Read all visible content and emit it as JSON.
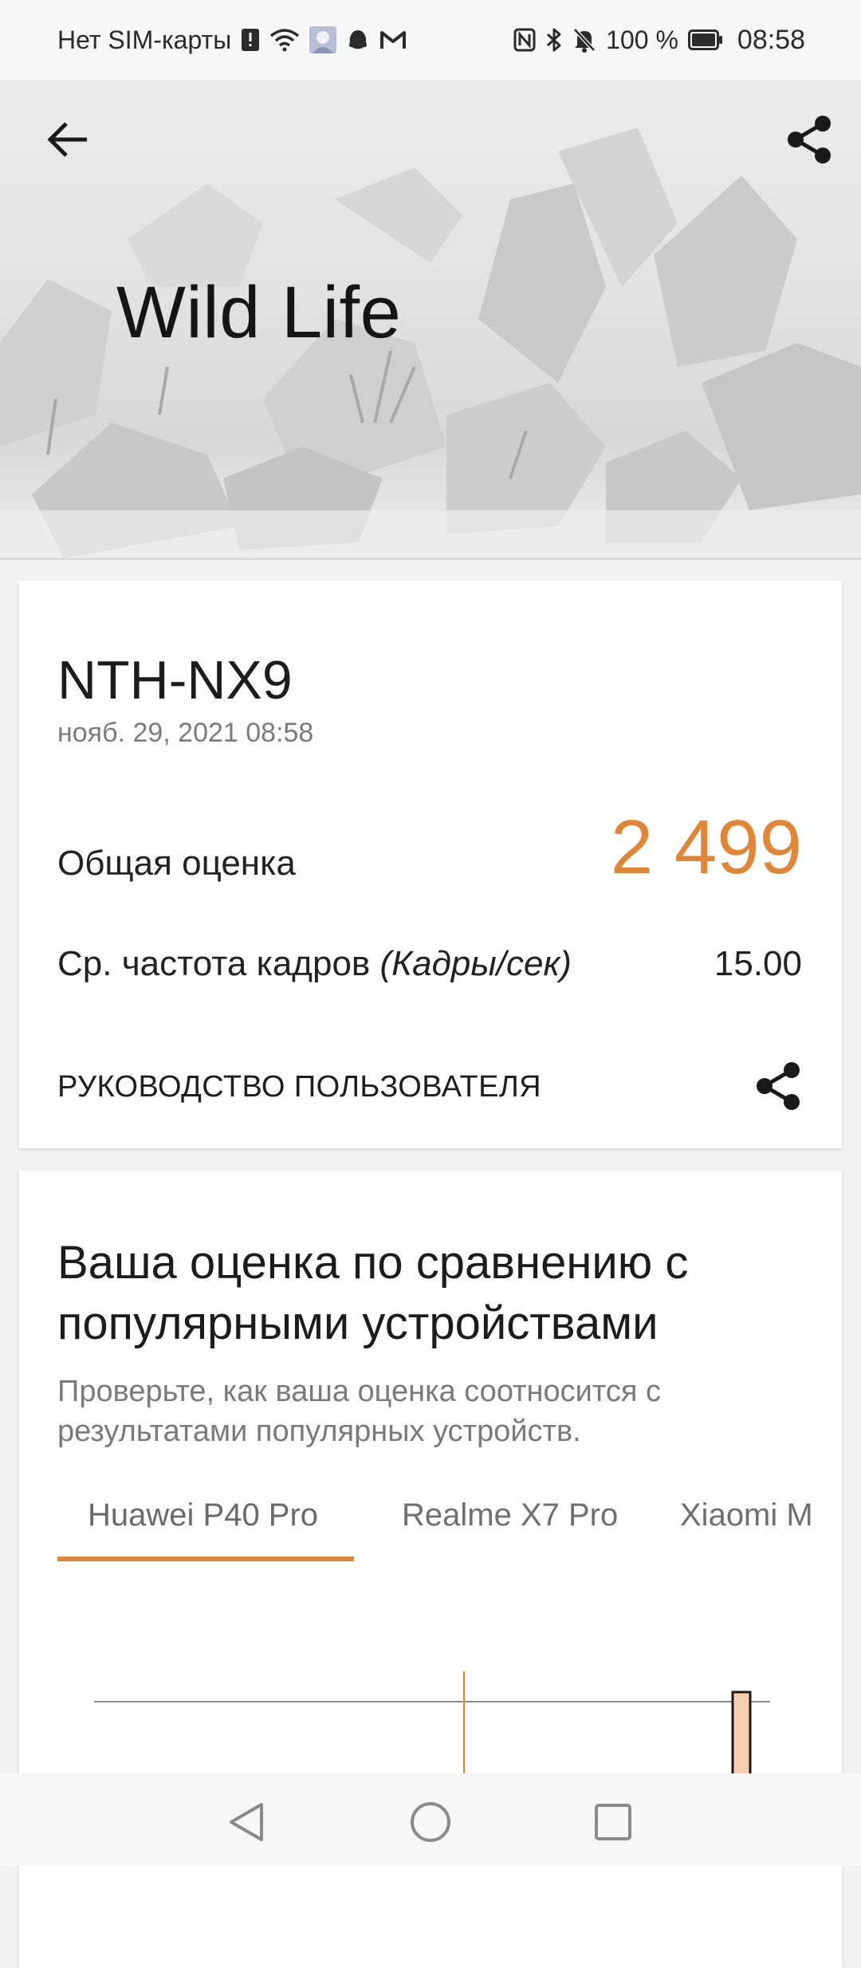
{
  "status_bar": {
    "carrier": "Нет SIM-карты",
    "battery": "100 %",
    "time": "08:58",
    "icons_left": [
      "alert-sim-icon",
      "wifi-icon",
      "avatar-notification-icon",
      "app-notification-icon",
      "gmail-icon"
    ],
    "icons_right": [
      "nfc-icon",
      "bluetooth-icon",
      "mute-icon",
      "battery-icon"
    ]
  },
  "header": {
    "title": "Wild Life",
    "back_icon": "arrow-left-icon",
    "share_icon": "share-icon"
  },
  "result": {
    "device": "NTH-NX9",
    "date": "нояб. 29, 2021 08:58",
    "score_label": "Общая оценка",
    "score": "2 499",
    "fps_label": "Ср. частота кадров",
    "fps_unit": "(Кадры/сек)",
    "fps": "15.00",
    "guide_label": "РУКОВОДСТВО ПОЛЬЗОВАТЕЛЯ"
  },
  "comparison": {
    "title": "Ваша оценка по сравнению с популярными устройствами",
    "subtitle": "Проверьте, как ваша оценка соотносится с результатами популярных устройств.",
    "tabs": [
      {
        "label": "Huawei P40 Pro",
        "active": true
      },
      {
        "label": "Realme X7 Pro",
        "active": false
      },
      {
        "label": "Xiaomi M",
        "active": false
      }
    ]
  },
  "colors": {
    "accent": "#e08636",
    "bar_fill": "#f6cfae"
  },
  "nav": {
    "icons": [
      "back-triangle-icon",
      "home-circle-icon",
      "recents-square-icon"
    ]
  }
}
